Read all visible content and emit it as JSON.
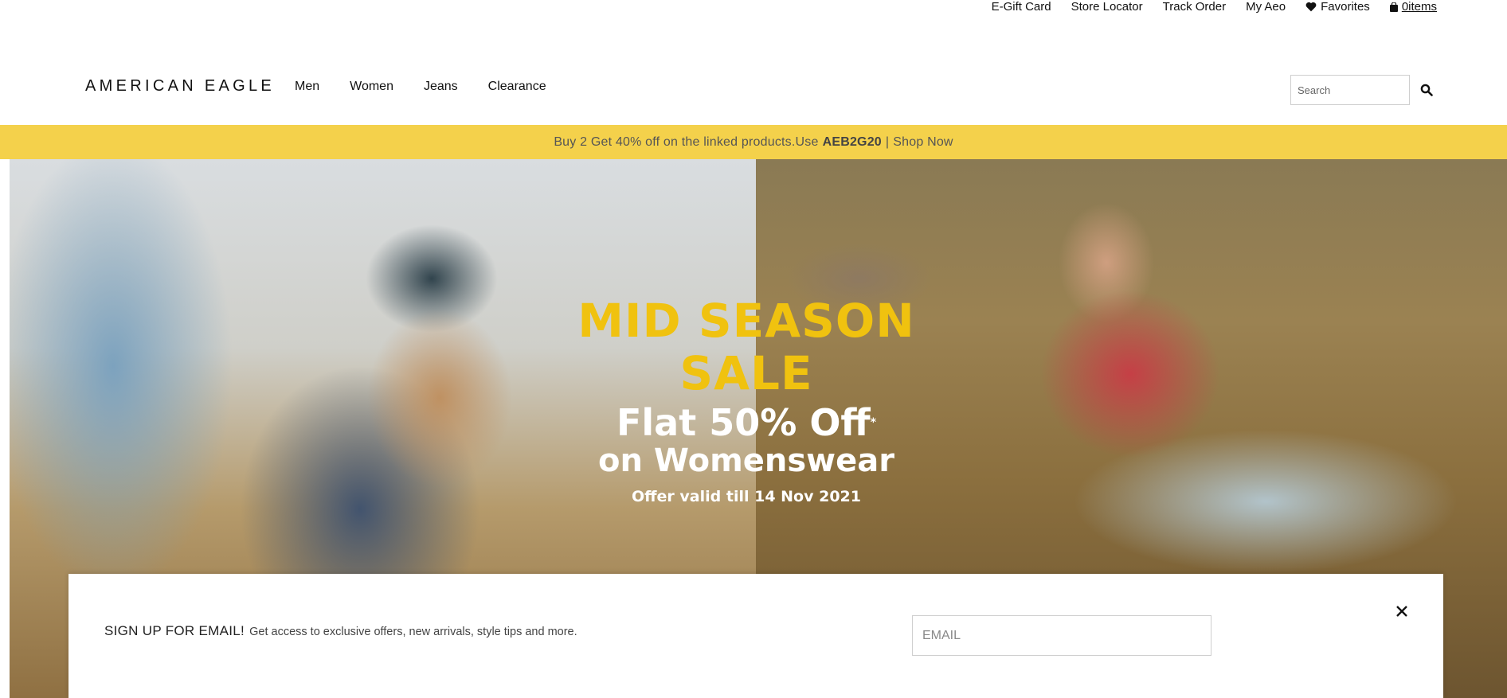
{
  "utility": {
    "egift": "E-Gift Card",
    "store_locator": "Store Locator",
    "track_order": "Track Order",
    "my_aeo": "My Aeo",
    "favorites": "Favorites",
    "items": "0items"
  },
  "header": {
    "logo": "AMERICAN EAGLE",
    "nav": [
      "Men",
      "Women",
      "Jeans",
      "Clearance"
    ],
    "search_placeholder": "Search"
  },
  "promo": {
    "text": "Buy 2 Get 40% off on the linked products.Use",
    "code": "AEB2G20",
    "separator": "|",
    "link": "Shop Now"
  },
  "hero": {
    "headline": "MID SEASON SALE",
    "line1": "Flat 50% Off",
    "line1_mark": "*",
    "line2": "on Womenswear",
    "valid": "Offer valid till 14 Nov 2021"
  },
  "signup": {
    "lead": "SIGN UP FOR EMAIL!",
    "body": "Get access to exclusive offers, new arrivals, style tips and more.",
    "email_placeholder": "EMAIL"
  },
  "colors": {
    "promo_bg": "#f4d14b",
    "headline": "#f0c20f"
  }
}
